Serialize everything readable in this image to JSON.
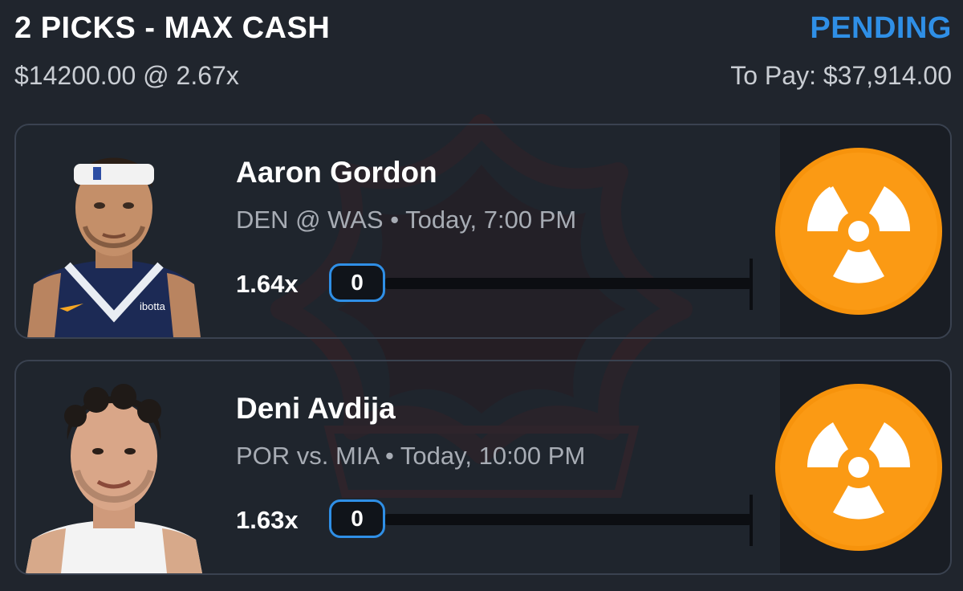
{
  "header": {
    "title": "2 PICKS - MAX CASH",
    "status": "PENDING",
    "stake": "$14200.00 @ 2.67x",
    "to_pay": "To Pay: $37,914.00"
  },
  "picks": [
    {
      "player": "Aaron Gordon",
      "matchup": "DEN @ WAS • Today, 7:00 PM",
      "multiplier": "1.64x",
      "current_value": "0",
      "progress": 0,
      "status_icon": "radioactive-icon"
    },
    {
      "player": "Deni Avdija",
      "matchup": "POR vs. MIA • Today, 10:00 PM",
      "multiplier": "1.63x",
      "current_value": "0",
      "progress": 0,
      "status_icon": "radioactive-icon"
    }
  ],
  "colors": {
    "accent": "#2f8fe6",
    "background": "#20252d",
    "icon_orange": "#f7930c"
  }
}
